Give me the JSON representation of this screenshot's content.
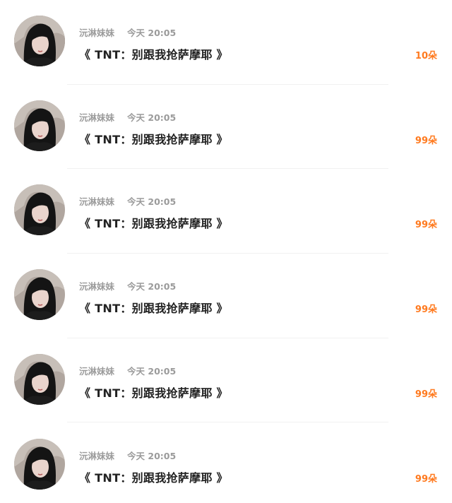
{
  "colors": {
    "accent": "#ff7a1f",
    "meta_text": "#9b9b9b",
    "title_text": "#222222",
    "divider": "#f1f1f1"
  },
  "items": [
    {
      "name": "沅淋妹妹",
      "time": "今天 20:05",
      "title": "《 TNT：别跟我抢萨摩耶 》",
      "count": "10朵",
      "avatar_icon": "user-avatar-photo"
    },
    {
      "name": "沅淋妹妹",
      "time": "今天 20:05",
      "title": "《 TNT：别跟我抢萨摩耶 》",
      "count": "99朵",
      "avatar_icon": "user-avatar-photo"
    },
    {
      "name": "沅淋妹妹",
      "time": "今天 20:05",
      "title": "《 TNT：别跟我抢萨摩耶 》",
      "count": "99朵",
      "avatar_icon": "user-avatar-photo"
    },
    {
      "name": "沅淋妹妹",
      "time": "今天 20:05",
      "title": "《 TNT：别跟我抢萨摩耶 》",
      "count": "99朵",
      "avatar_icon": "user-avatar-photo"
    },
    {
      "name": "沅淋妹妹",
      "time": "今天 20:05",
      "title": "《 TNT：别跟我抢萨摩耶 》",
      "count": "99朵",
      "avatar_icon": "user-avatar-photo"
    },
    {
      "name": "沅淋妹妹",
      "time": "今天 20:05",
      "title": "《 TNT：别跟我抢萨摩耶 》",
      "count": "99朵",
      "avatar_icon": "user-avatar-photo"
    }
  ]
}
